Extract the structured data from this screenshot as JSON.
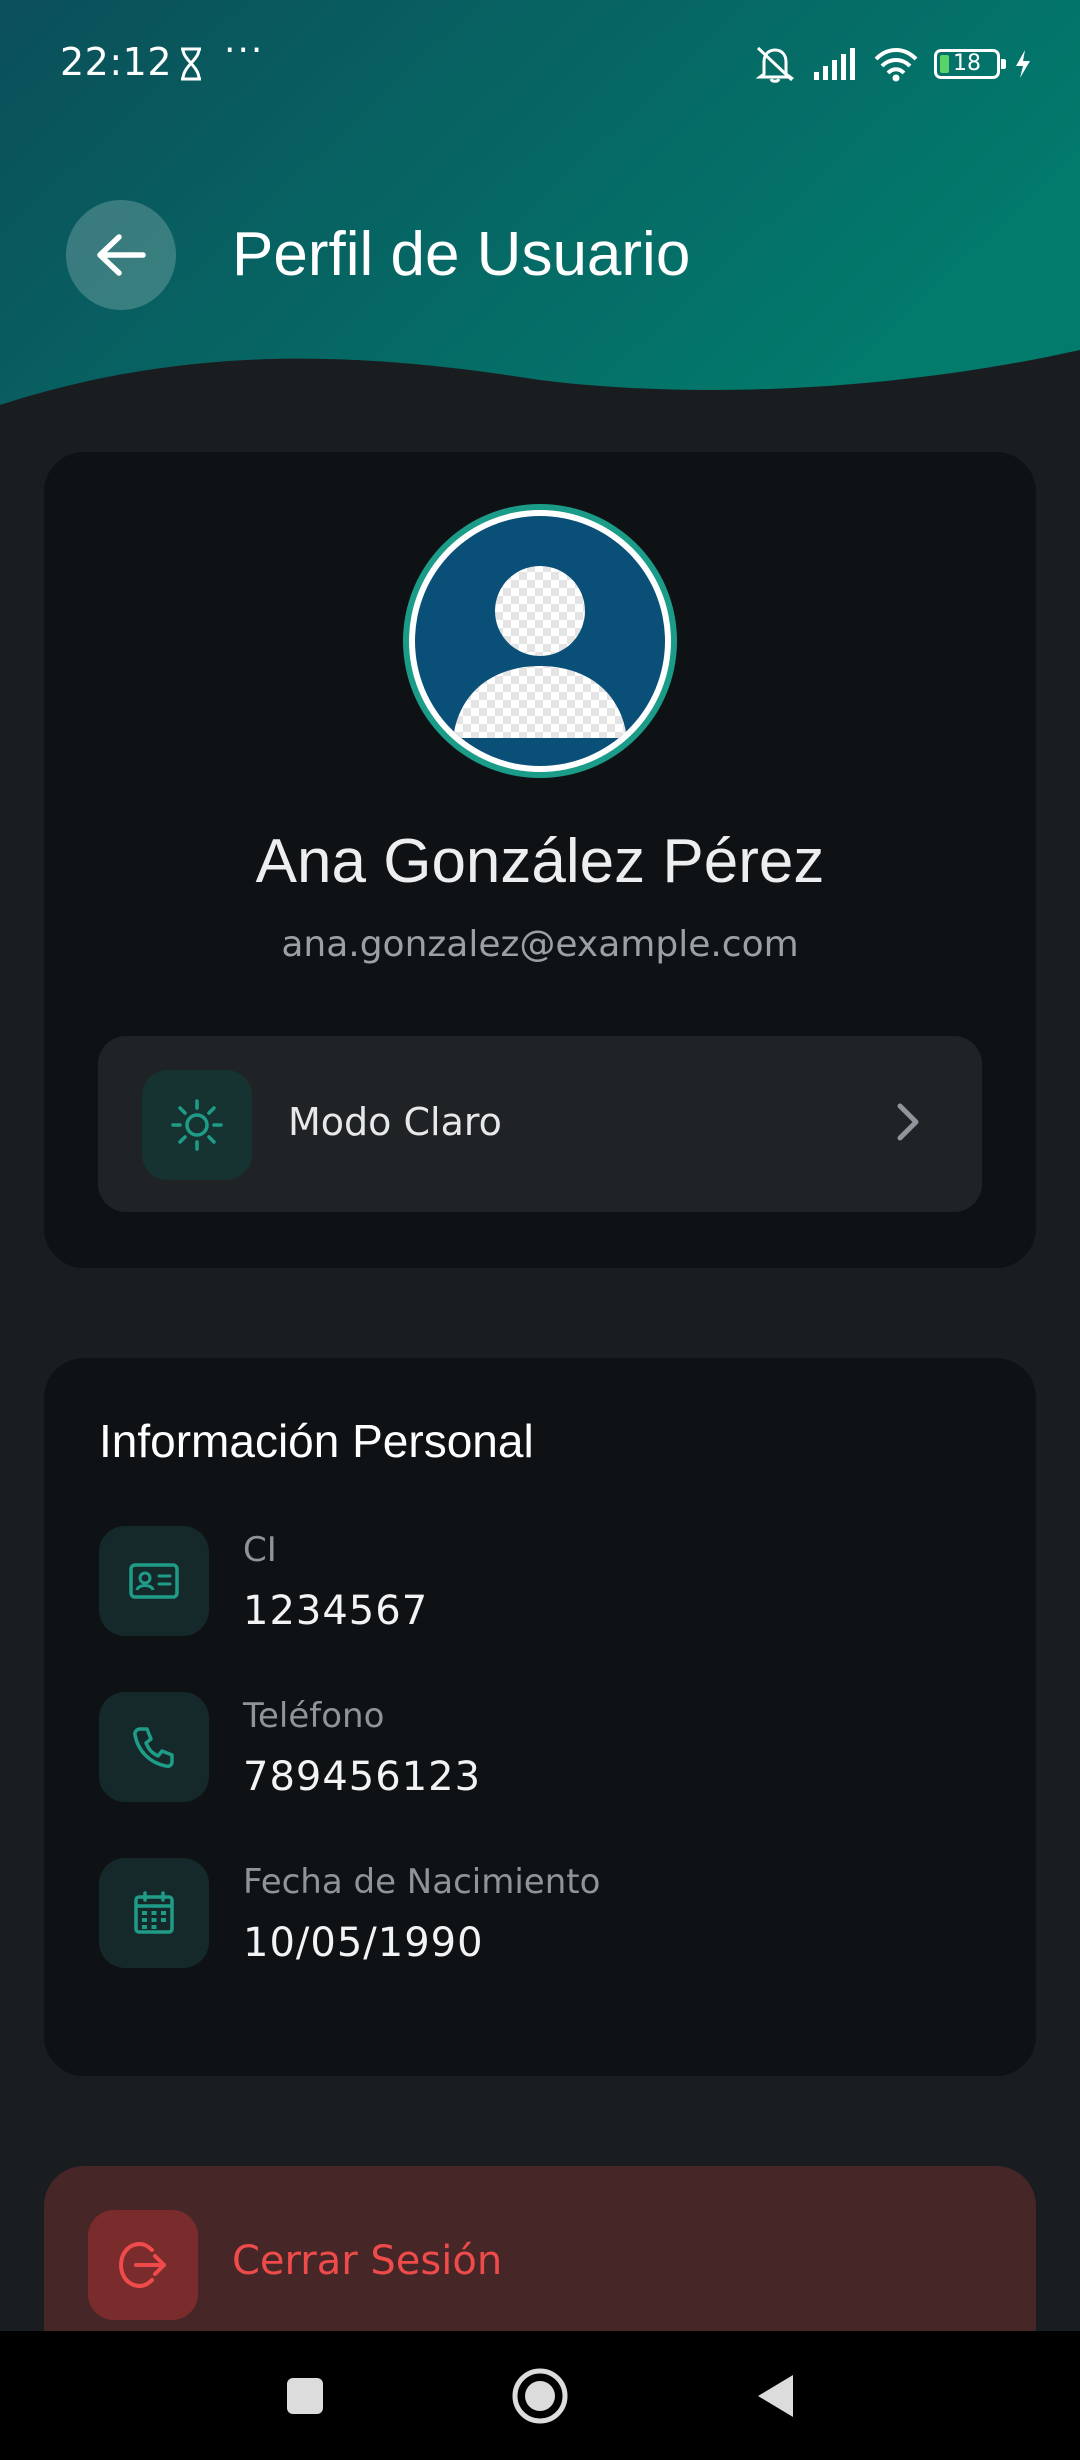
{
  "status_bar": {
    "time": "22:12",
    "dots": "···",
    "battery": "18"
  },
  "header": {
    "title": "Perfil de Usuario"
  },
  "profile": {
    "name": "Ana González Pérez",
    "email": "ana.gonzalez@example.com",
    "theme_label": "Modo Claro"
  },
  "personal_info": {
    "title": "Información Personal",
    "items": [
      {
        "label": "CI",
        "value": "1234567",
        "icon": "id-card-icon"
      },
      {
        "label": "Teléfono",
        "value": "789456123",
        "icon": "phone-icon"
      },
      {
        "label": "Fecha de Nacimiento",
        "value": "10/05/1990",
        "icon": "calendar-icon"
      }
    ]
  },
  "logout": {
    "label": "Cerrar Sesión"
  },
  "colors": {
    "accent": "#1a9c88",
    "header_start": "#0b4f5a",
    "header_end": "#027a6c",
    "background": "#1a1d20",
    "card": "#0f1214",
    "danger": "#ef4b4b"
  }
}
